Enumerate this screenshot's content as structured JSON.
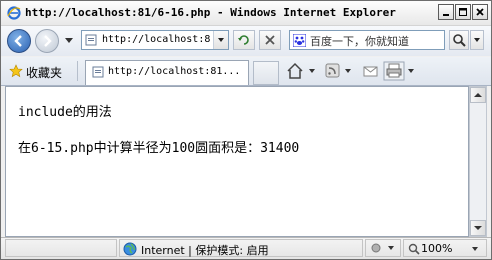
{
  "window": {
    "title": "http://localhost:81/6-16.php - Windows Internet Explorer"
  },
  "navigation": {
    "address": "http://localhost:8",
    "search_placeholder": "百度一下，你就知道"
  },
  "command_bar": {
    "favorites_label": "收藏夹",
    "tab_title": "http://localhost:81..."
  },
  "content": {
    "heading": "include的用法",
    "result": "在6-15.php中计算半径为100圆面积是：31400"
  },
  "status_bar": {
    "zone": "Internet | 保护模式: 启用",
    "zoom": "100%"
  },
  "colors": {
    "accent": "#2b62b3",
    "window_frame": "#6d6d6d"
  }
}
